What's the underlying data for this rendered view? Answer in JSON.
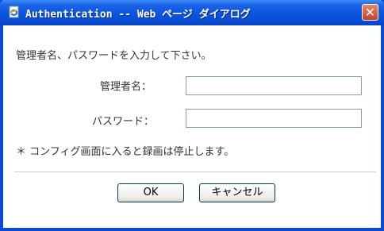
{
  "window": {
    "title": "Authentication -- Web ページ ダイアログ",
    "close_label": "✕"
  },
  "prompt": "管理者名、パスワードを入力して下さい。",
  "fields": {
    "username": {
      "label": "管理者名：",
      "value": ""
    },
    "password": {
      "label": "パスワード：",
      "value": ""
    }
  },
  "notice": "＊ コンフィグ画面に入ると録画は停止します。",
  "buttons": {
    "ok": "OK",
    "cancel": "キャンセル"
  },
  "colors": {
    "titlebar": "#0a4bd3",
    "close": "#c2412a",
    "input_border": "#7f9db9"
  }
}
